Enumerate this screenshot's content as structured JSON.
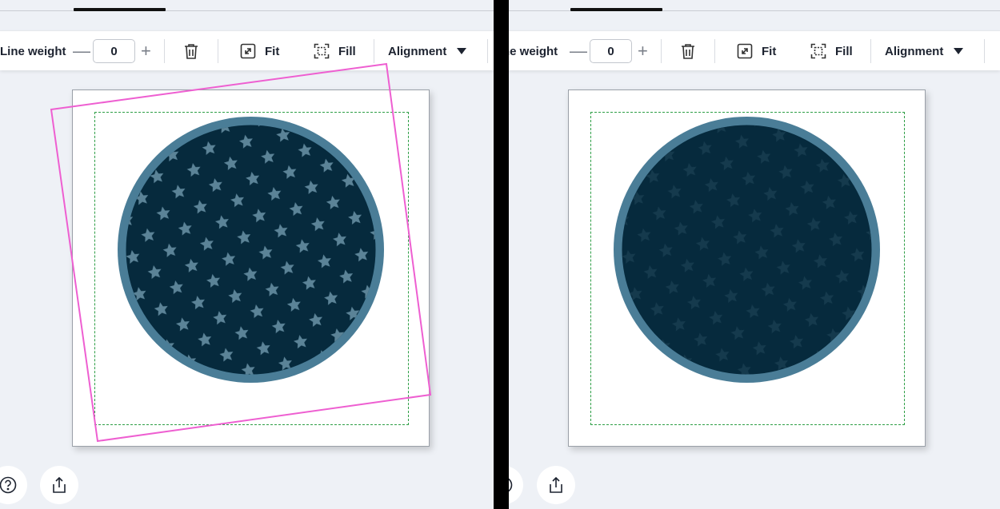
{
  "toolbar": {
    "line_weight_label": "Line weight",
    "line_weight_label_clipped": "ne weight",
    "decrement_symbol": "—",
    "increment_symbol": "+",
    "line_weight_value": "0",
    "fit_label": "Fit",
    "fill_label": "Fill",
    "alignment_label": "Alignment",
    "icons": [
      "trash-icon",
      "fit-expand-icon",
      "fill-frame-icon",
      "caret-down-icon"
    ]
  },
  "design": {
    "disc_fill": "#062a3d",
    "disc_rim": "#4a7d97",
    "star_color_left": "#5b8397",
    "star_color_right": "#153a4d",
    "safe_area_color": "#2d9e45",
    "selection_color": "#ee5fd1"
  },
  "bottom_buttons": {
    "icons": [
      "help-icon",
      "share-icon"
    ]
  }
}
